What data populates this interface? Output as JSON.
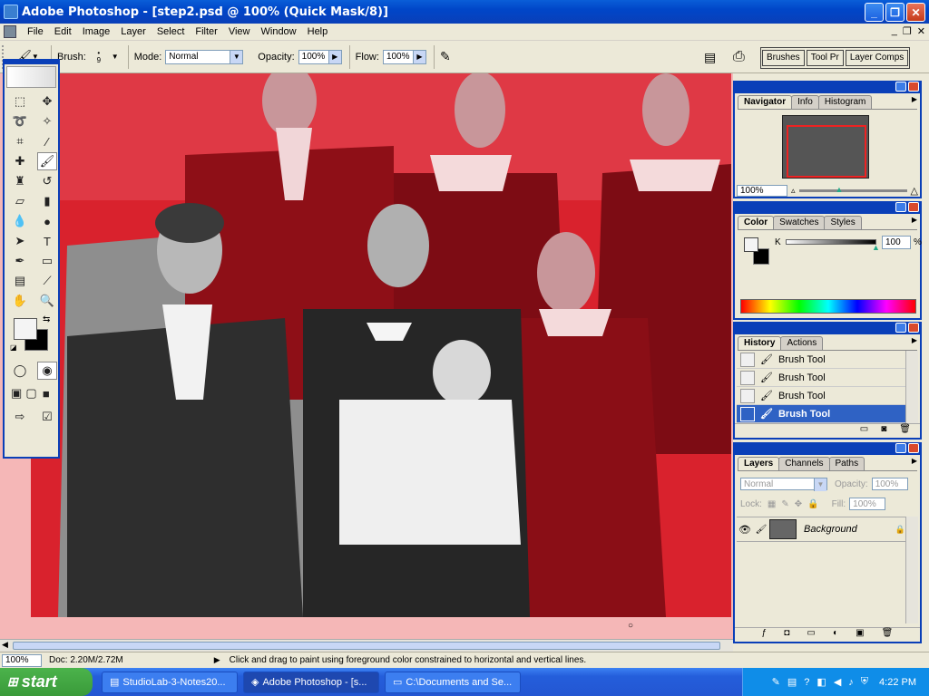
{
  "window": {
    "title": "Adobe Photoshop - [step2.psd @ 100% (Quick Mask/8)]"
  },
  "menu": [
    "File",
    "Edit",
    "Image",
    "Layer",
    "Select",
    "Filter",
    "View",
    "Window",
    "Help"
  ],
  "options": {
    "brush_label": "Brush:",
    "brush_size": "9",
    "mode_label": "Mode:",
    "mode_value": "Normal",
    "opacity_label": "Opacity:",
    "opacity_value": "100%",
    "flow_label": "Flow:",
    "flow_value": "100%"
  },
  "palette_well": [
    "Brushes",
    "Tool Pr",
    "Layer Comps"
  ],
  "navigator": {
    "tabs": [
      "Navigator",
      "Info",
      "Histogram"
    ],
    "zoom": "100%"
  },
  "color": {
    "tabs": [
      "Color",
      "Swatches",
      "Styles"
    ],
    "channel_label": "K",
    "channel_value": "100",
    "unit": "%"
  },
  "history": {
    "tabs": [
      "History",
      "Actions"
    ],
    "items": [
      "Brush Tool",
      "Brush Tool",
      "Brush Tool",
      "Brush Tool"
    ]
  },
  "layers": {
    "tabs": [
      "Layers",
      "Channels",
      "Paths"
    ],
    "blend_mode": "Normal",
    "opacity_label": "Opacity:",
    "opacity_value": "100%",
    "lock_label": "Lock:",
    "fill_label": "Fill:",
    "fill_value": "100%",
    "layer_name": "Background"
  },
  "status": {
    "zoom": "100%",
    "doc": "Doc: 2.20M/2.72M",
    "hint": "Click and drag to paint using foreground color constrained to horizontal and vertical lines."
  },
  "taskbar": {
    "start_label": "start",
    "tasks": [
      "StudioLab-3-Notes20...",
      "Adobe Photoshop - [s...",
      "C:\\Documents and Se..."
    ],
    "clock": "4:22 PM"
  },
  "colors": {
    "quick_mask": "#d9222d",
    "xp_blue": "#0a3fb8"
  }
}
